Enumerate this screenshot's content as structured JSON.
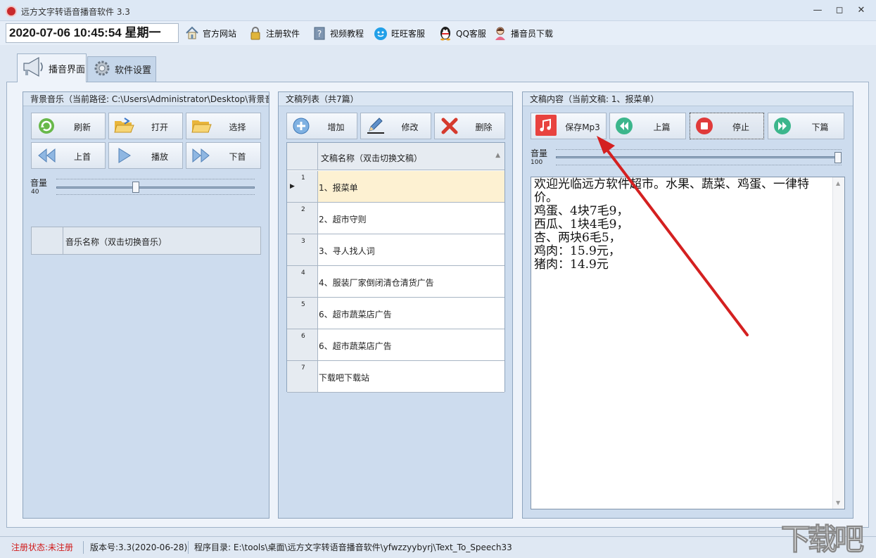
{
  "window": {
    "title": "远方文字转语音播音软件 3.3",
    "controls": [
      "minimize",
      "maximize",
      "close"
    ]
  },
  "toolbar": {
    "datetime": "2020-07-06 10:45:54 星期一",
    "links": [
      {
        "label": "官方网站",
        "icon": "home-icon"
      },
      {
        "label": "注册软件",
        "icon": "lock-icon"
      },
      {
        "label": "视频教程",
        "icon": "help-book-icon"
      },
      {
        "label": "旺旺客服",
        "icon": "wangwang-icon"
      },
      {
        "label": "QQ客服",
        "icon": "qq-penguin-icon"
      },
      {
        "label": "播音员下载",
        "icon": "announcer-icon"
      }
    ]
  },
  "tabs": [
    {
      "label": "播音界面",
      "icon": "megaphone-icon",
      "active": true
    },
    {
      "label": "软件设置",
      "icon": "gear-icon",
      "active": false
    }
  ],
  "music_panel": {
    "title": "背景音乐（当前路径: C:\\Users\\Administrator\\Desktop\\背景音乐",
    "buttons": [
      "刷新",
      "打开",
      "选择",
      "上首",
      "播放",
      "下首"
    ],
    "volume_label": "音量",
    "volume_value": "40",
    "volume_level": 0.4,
    "grid_header": "音乐名称（双击切换音乐）"
  },
  "doc_panel": {
    "title": "文稿列表（共7篇）",
    "buttons": [
      "增加",
      "修改",
      "删除"
    ],
    "grid_header": "文稿名称（双击切换文稿）",
    "rows": [
      {
        "num": "1",
        "name": "1、报菜单"
      },
      {
        "num": "2",
        "name": "2、超市守则"
      },
      {
        "num": "3",
        "name": "3、寻人找人词"
      },
      {
        "num": "4",
        "name": "4、服装厂家倒闭清仓清货广告"
      },
      {
        "num": "5",
        "name": "6、超市蔬菜店广告"
      },
      {
        "num": "6",
        "name": "6、超市蔬菜店广告"
      },
      {
        "num": "7",
        "name": "下载吧下载站"
      }
    ],
    "selected_row": 0
  },
  "content_panel": {
    "title": "文稿内容（当前文稿: 1、报菜单）",
    "buttons": [
      "保存Mp3",
      "上篇",
      "停止",
      "下篇"
    ],
    "volume_label": "音量",
    "volume_value": "100",
    "volume_level": 1.0,
    "text": "欢迎光临远方软件超市。水果、蔬菜、鸡蛋、一律特价。\n鸡蛋、4块7毛9，\n西瓜、1块4毛9，\n杏、两块6毛5，\n鸡肉：15.9元，\n猪肉：14.9元"
  },
  "statusbar": {
    "reg_status": "注册状态:未注册",
    "version": "版本号:3.3(2020-06-28)",
    "program_dir": "程序目录: E:\\tools\\桌面\\远方文字转语音播音软件\\yfwzzyybyrj\\Text_To_Speech33"
  },
  "watermark": "下载吧",
  "colors": {
    "panel_bg": "#cddcee",
    "accent_red": "#d01818",
    "selected_row": "#fdf1d2",
    "arrow": "#d42020"
  }
}
